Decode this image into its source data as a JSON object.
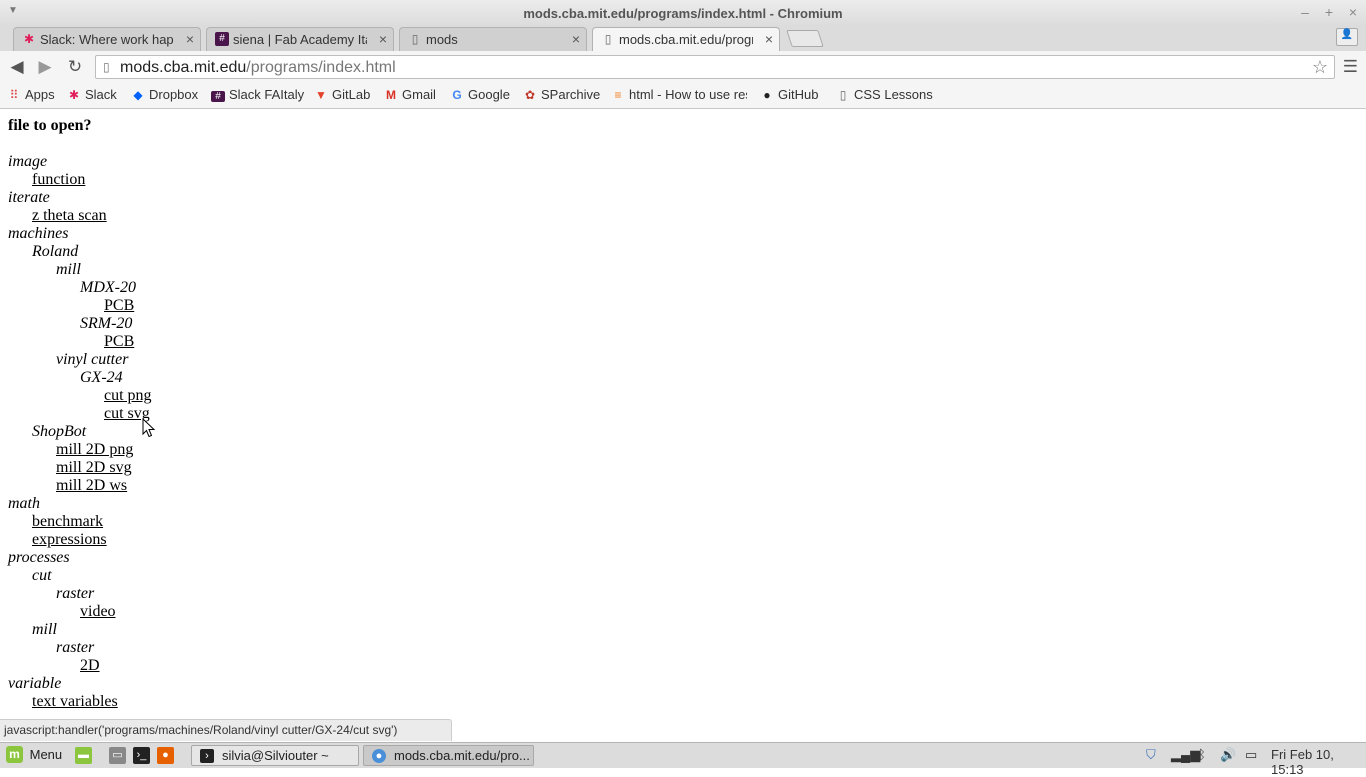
{
  "window": {
    "title": "mods.cba.mit.edu/programs/index.html - Chromium",
    "minimize_glyph": "–",
    "maximize_glyph": "+",
    "close_glyph": "×"
  },
  "tabs": [
    {
      "label": "Slack: Where work happe",
      "icon": "slack-icon"
    },
    {
      "label": "siena | Fab Academy Ita",
      "icon": "hash-icon"
    },
    {
      "label": "mods",
      "icon": "page-icon"
    },
    {
      "label": "mods.cba.mit.edu/progra",
      "icon": "page-icon",
      "active": true
    }
  ],
  "toolbar": {
    "url_host": "mods.cba.mit.edu",
    "url_path": "/programs/index.html"
  },
  "bookmarks": [
    {
      "label": "Apps",
      "icon": "apps-grid-icon"
    },
    {
      "label": "Slack",
      "icon": "slack-icon"
    },
    {
      "label": "Dropbox",
      "icon": "dropbox-icon"
    },
    {
      "label": "Slack FAItaly",
      "icon": "hash-icon"
    },
    {
      "label": "GitLab",
      "icon": "gitlab-icon"
    },
    {
      "label": "Gmail",
      "icon": "gmail-icon"
    },
    {
      "label": "Google",
      "icon": "google-icon"
    },
    {
      "label": "SParchive",
      "icon": "sparchive-icon"
    },
    {
      "label": "html - How to use res",
      "icon": "stackoverflow-icon"
    },
    {
      "label": "GitHub",
      "icon": "github-icon"
    },
    {
      "label": "CSS Lessons",
      "icon": "page-icon"
    }
  ],
  "page": {
    "heading": "file to open?",
    "tree": [
      {
        "text": "image",
        "level": 0,
        "kind": "category"
      },
      {
        "text": "function",
        "level": 1,
        "kind": "link"
      },
      {
        "text": "iterate",
        "level": 0,
        "kind": "category"
      },
      {
        "text": "z theta scan",
        "level": 1,
        "kind": "link"
      },
      {
        "text": "machines",
        "level": 0,
        "kind": "category"
      },
      {
        "text": "Roland",
        "level": 1,
        "kind": "category"
      },
      {
        "text": "mill",
        "level": 2,
        "kind": "category"
      },
      {
        "text": "MDX-20",
        "level": 3,
        "kind": "category"
      },
      {
        "text": "PCB",
        "level": 4,
        "kind": "link"
      },
      {
        "text": "SRM-20",
        "level": 3,
        "kind": "category"
      },
      {
        "text": "PCB",
        "level": 4,
        "kind": "link"
      },
      {
        "text": "vinyl cutter",
        "level": 2,
        "kind": "category"
      },
      {
        "text": "GX-24",
        "level": 3,
        "kind": "category"
      },
      {
        "text": "cut png",
        "level": 4,
        "kind": "link"
      },
      {
        "text": "cut svg",
        "level": 4,
        "kind": "link"
      },
      {
        "text": "ShopBot",
        "level": 1,
        "kind": "category"
      },
      {
        "text": "mill 2D png",
        "level": 2,
        "kind": "link"
      },
      {
        "text": "mill 2D svg",
        "level": 2,
        "kind": "link"
      },
      {
        "text": "mill 2D ws",
        "level": 2,
        "kind": "link"
      },
      {
        "text": "math",
        "level": 0,
        "kind": "category"
      },
      {
        "text": "benchmark",
        "level": 1,
        "kind": "link"
      },
      {
        "text": "expressions",
        "level": 1,
        "kind": "link"
      },
      {
        "text": "processes",
        "level": 0,
        "kind": "category"
      },
      {
        "text": "cut",
        "level": 1,
        "kind": "category"
      },
      {
        "text": "raster",
        "level": 2,
        "kind": "category"
      },
      {
        "text": "video",
        "level": 3,
        "kind": "link"
      },
      {
        "text": "mill",
        "level": 1,
        "kind": "category"
      },
      {
        "text": "raster",
        "level": 2,
        "kind": "category"
      },
      {
        "text": "2D",
        "level": 3,
        "kind": "link"
      },
      {
        "text": "variable",
        "level": 0,
        "kind": "category"
      },
      {
        "text": "text variables",
        "level": 1,
        "kind": "link"
      }
    ]
  },
  "status_text": "javascript:handler('programs/machines/Roland/vinyl cutter/GX-24/cut svg')",
  "taskbar": {
    "menu_label": "Menu",
    "windows": [
      {
        "label": "silvia@Silviouter ~",
        "icon": "terminal-icon"
      },
      {
        "label": "mods.cba.mit.edu/pro...",
        "icon": "chromium-icon",
        "active": true
      }
    ],
    "clock": "Fri Feb 10, 15:13"
  },
  "colors": {
    "link": "#000000",
    "chrome_bg": "#f5f5f5",
    "taskbar_bg": "#dcdcdc",
    "mint_green": "#8cc63f"
  }
}
